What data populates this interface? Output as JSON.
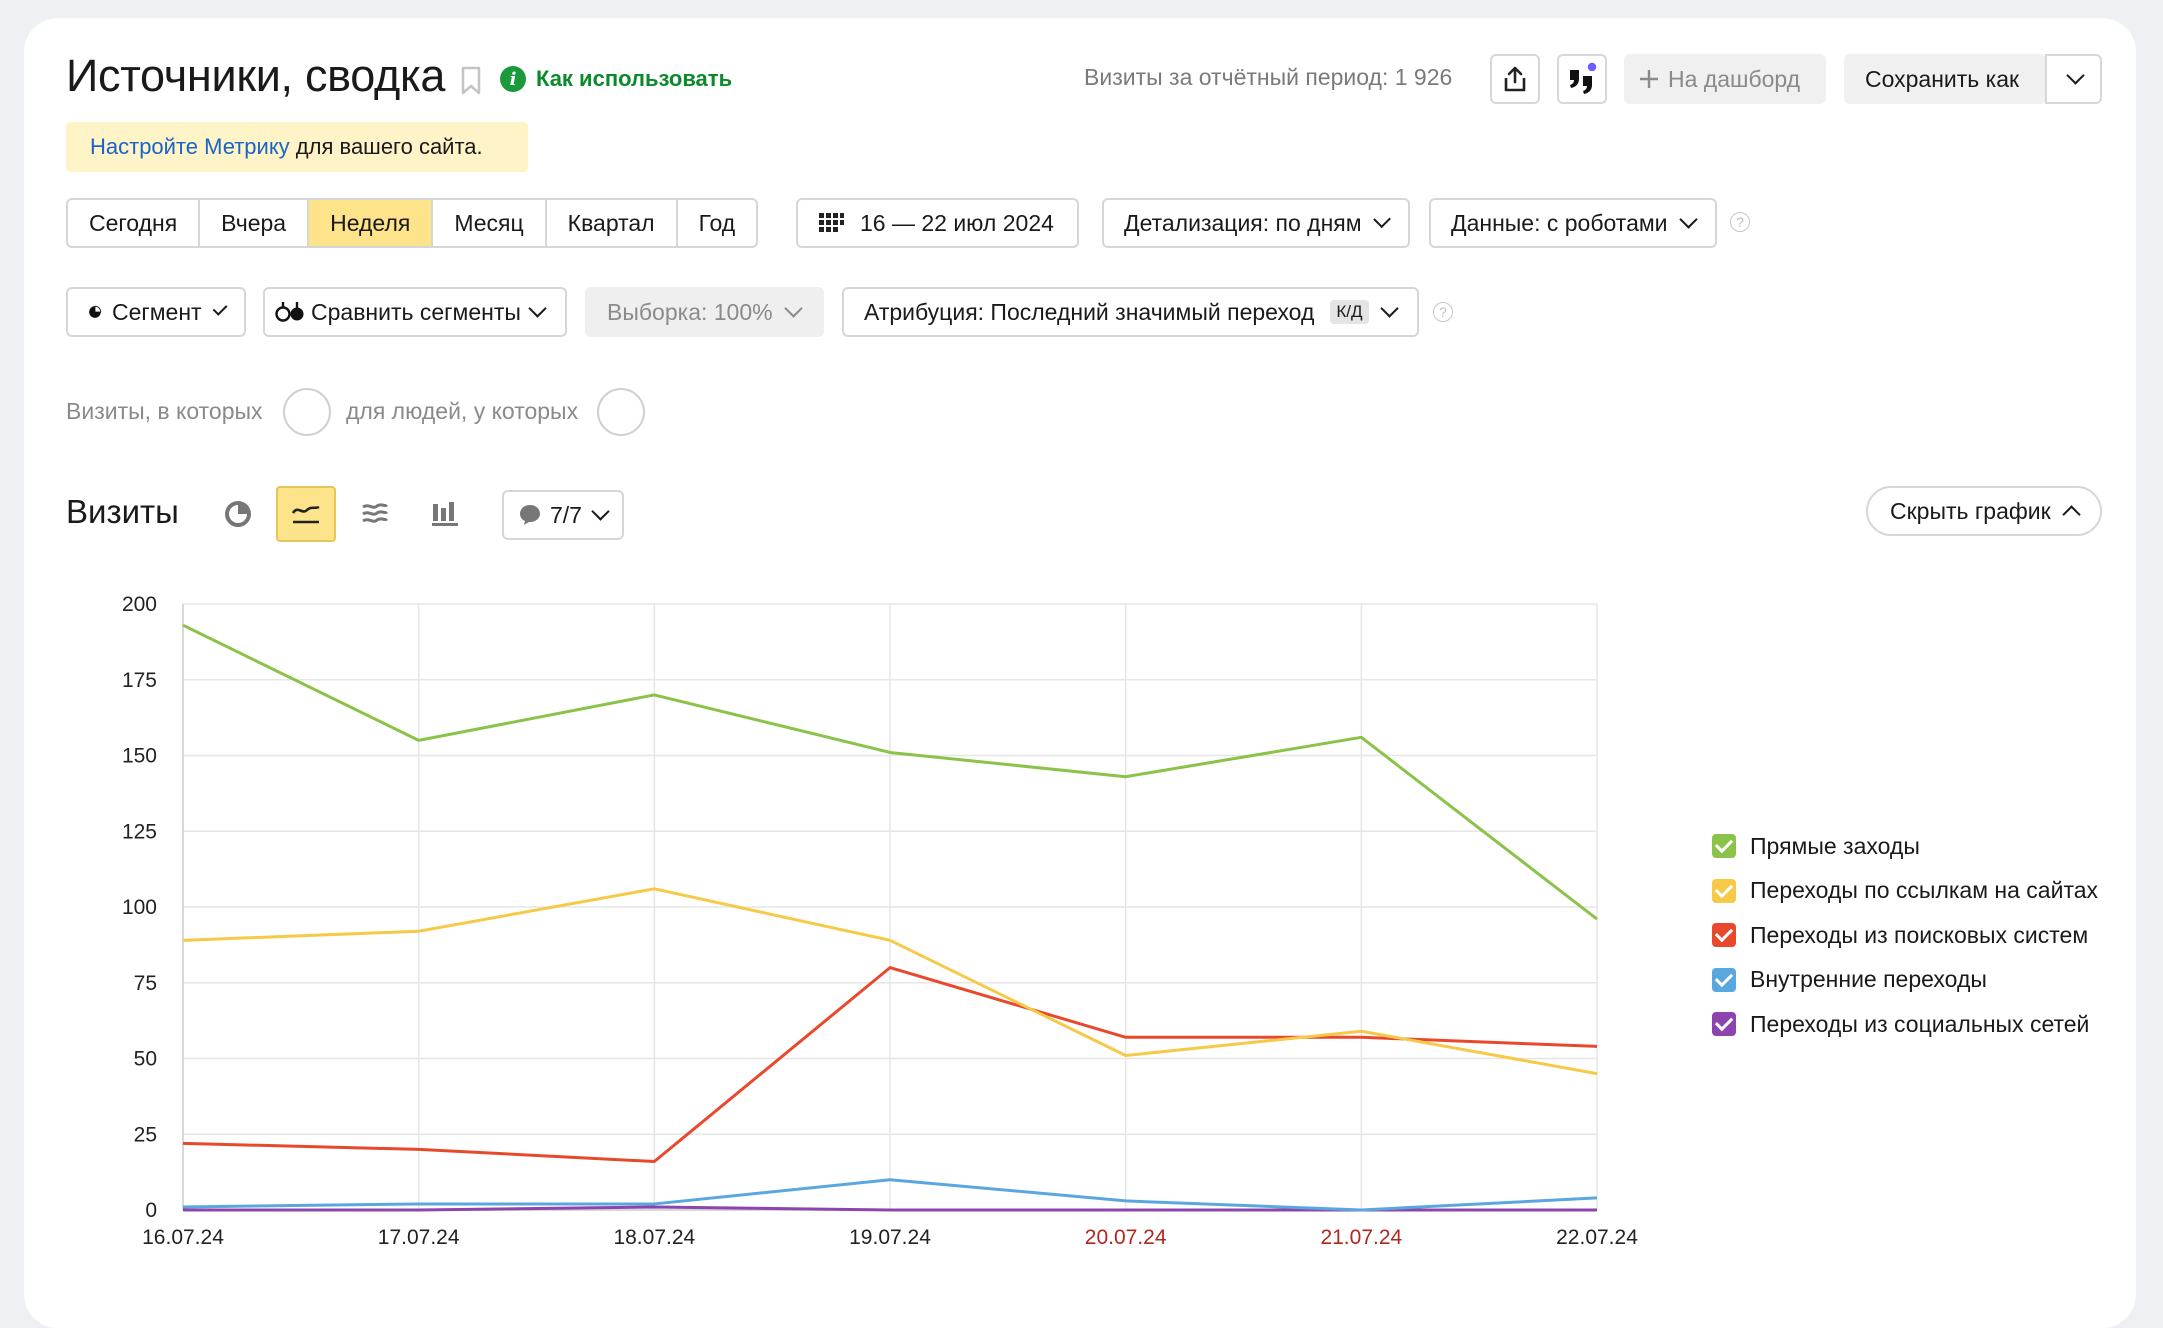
{
  "header": {
    "title": "Источники, сводка",
    "howto_label": "Как использовать",
    "visits_total": "Визиты за отчётный период: 1 926",
    "dashboard_label": "На дашборд",
    "save_as_label": "Сохранить как"
  },
  "notice": {
    "link": "Настройте Метрику",
    "text": " для вашего сайта."
  },
  "periods": [
    "Сегодня",
    "Вчера",
    "Неделя",
    "Месяц",
    "Квартал",
    "Год"
  ],
  "active_period": "Неделя",
  "date_range": "16 — 22 июл 2024",
  "detail": "Детализация: по дням",
  "data_mode": "Данные: с роботами",
  "segment_label": "Сегмент",
  "compare_label": "Сравнить сегменты",
  "sample_label": "Выборка: 100%",
  "attribution_label": "Атрибуция: Последний значимый переход",
  "attribution_badge": "К/Д",
  "filters": {
    "visits_where": "Визиты, в которых",
    "people_where": "для людей, у которых"
  },
  "section": {
    "title": "Визиты",
    "series_counter": "7/7",
    "hide_chart": "Скрыть график"
  },
  "colors": {
    "accent_yellow": "#fde48a",
    "link_blue": "#1a64c8",
    "weekend": "#b3261e"
  },
  "chart_data": {
    "type": "line",
    "x": [
      "16.07.24",
      "17.07.24",
      "18.07.24",
      "19.07.24",
      "20.07.24",
      "21.07.24",
      "22.07.24"
    ],
    "weekend_x": [
      "20.07.24",
      "21.07.24"
    ],
    "ylim": [
      0,
      200
    ],
    "yticks": [
      0,
      25,
      50,
      75,
      100,
      125,
      150,
      175,
      200
    ],
    "grid": true,
    "legend_position": "right",
    "series": [
      {
        "name": "Прямые заходы",
        "color": "#8bc34a",
        "values": [
          193,
          155,
          170,
          151,
          143,
          156,
          96
        ]
      },
      {
        "name": "Переходы по ссылкам на сайтах",
        "color": "#f7c948",
        "values": [
          89,
          92,
          106,
          89,
          51,
          59,
          45
        ]
      },
      {
        "name": "Переходы из поисковых систем",
        "color": "#e8492d",
        "values": [
          22,
          20,
          16,
          80,
          57,
          57,
          54
        ]
      },
      {
        "name": "Внутренние переходы",
        "color": "#5aa7e0",
        "values": [
          1,
          2,
          2,
          10,
          3,
          0,
          4
        ]
      },
      {
        "name": "Переходы из социальных сетей",
        "color": "#8e44ad",
        "values": [
          0,
          0,
          1,
          0,
          0,
          0,
          0
        ]
      }
    ]
  }
}
